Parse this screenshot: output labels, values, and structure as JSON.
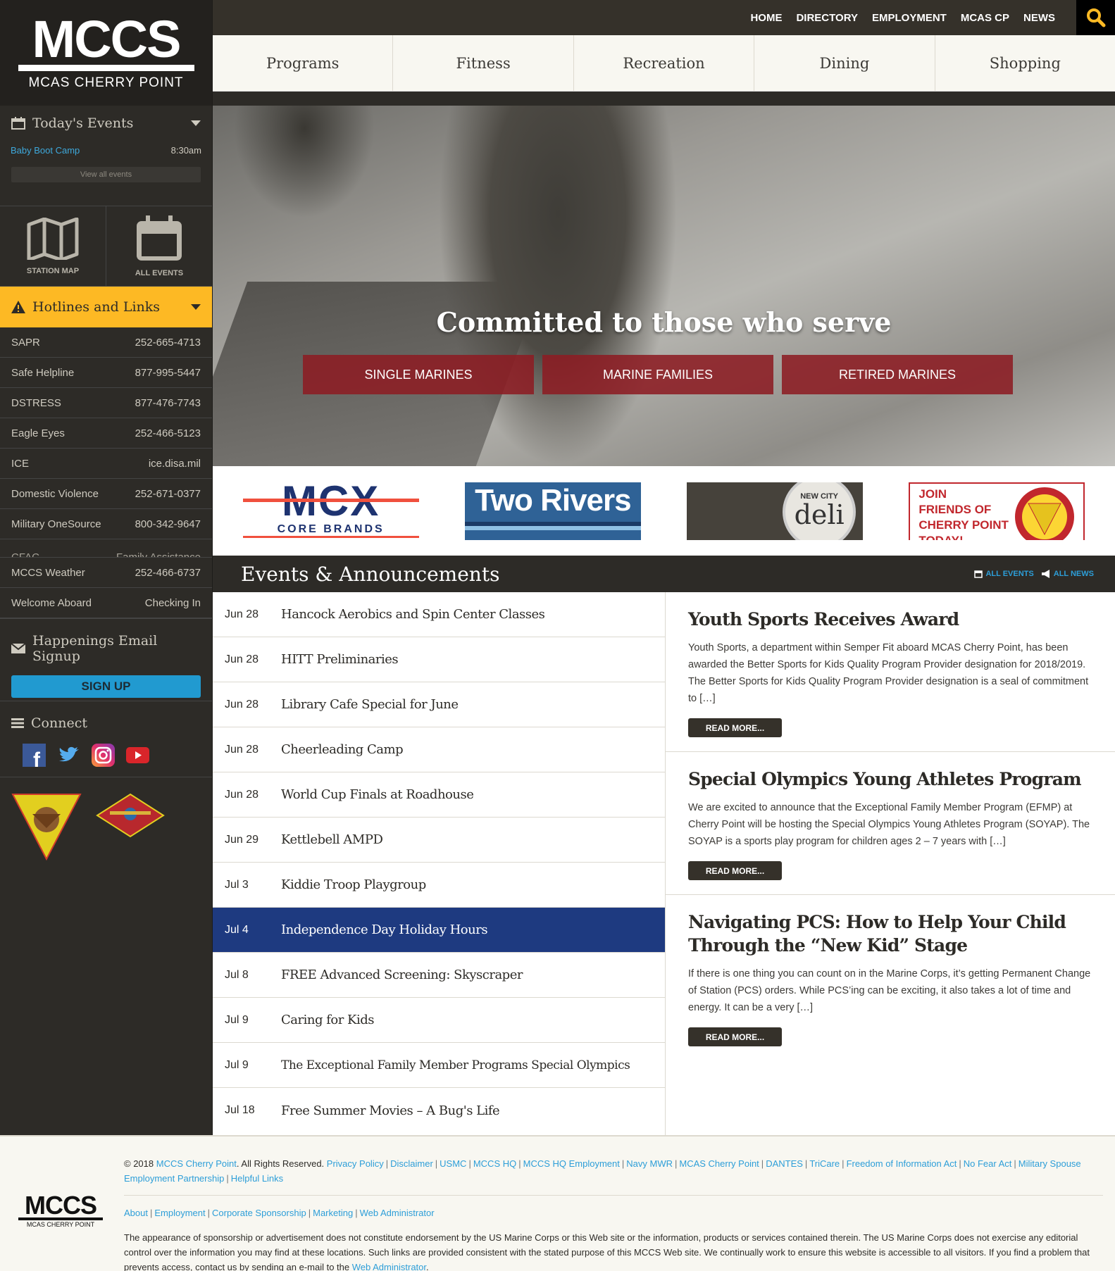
{
  "logo": {
    "mark": "MCCS",
    "subtitle": "MCAS CHERRY POINT"
  },
  "topnav": [
    "HOME",
    "DIRECTORY",
    "EMPLOYMENT",
    "MCAS CP",
    "NEWS"
  ],
  "mainnav": [
    "Programs",
    "Fitness",
    "Recreation",
    "Dining",
    "Shopping"
  ],
  "sidebar": {
    "today": {
      "title": "Today's Events",
      "events": [
        {
          "name": "Baby Boot Camp",
          "time": "8:30am"
        }
      ],
      "view_all": "View all events"
    },
    "tiles": [
      {
        "label": "STATION MAP",
        "icon": "map-icon"
      },
      {
        "label": "ALL EVENTS",
        "icon": "calendar-icon"
      }
    ],
    "hotlines": {
      "title": "Hotlines and Links",
      "items": [
        {
          "name": "SAPR",
          "value": "252-665-4713"
        },
        {
          "name": "Safe Helpline",
          "value": "877-995-5447"
        },
        {
          "name": "DSTRESS",
          "value": "877-476-7743"
        },
        {
          "name": "Eagle Eyes",
          "value": "252-466-5123"
        },
        {
          "name": "ICE",
          "value": "ice.disa.mil"
        },
        {
          "name": "Domestic Violence",
          "value": "252-671-0377"
        },
        {
          "name": "Military OneSource",
          "value": "800-342-9647"
        },
        {
          "name": "CFAC",
          "value": "Family Assistance"
        },
        {
          "name": "MCCS Weather",
          "value": "252-466-6737"
        },
        {
          "name": "Welcome Aboard",
          "value": "Checking In"
        }
      ]
    },
    "email": {
      "title": "Happenings Email Signup",
      "button": "SIGN UP"
    },
    "connect": {
      "title": "Connect",
      "social": [
        "facebook",
        "twitter",
        "instagram",
        "youtube"
      ]
    }
  },
  "hero": {
    "headline": "Committed to those who serve",
    "buttons": [
      "SINGLE MARINES",
      "MARINE FAMILIES",
      "RETIRED MARINES"
    ]
  },
  "sponsors": {
    "mcx": {
      "line1": "MCX",
      "line2": "CORE BRANDS"
    },
    "tworivers": "Two Rivers",
    "deli": {
      "top": "NEW CITY",
      "main": "deli"
    },
    "friends": {
      "lines": [
        "JOIN",
        "FRIENDS OF",
        "CHERRY POINT",
        "TODAY!"
      ]
    }
  },
  "events_section": {
    "title": "Events & Announcements",
    "all_events": "ALL EVENTS",
    "all_news": "ALL NEWS",
    "events": [
      {
        "date": "Jun 28",
        "name": "Hancock Aerobics and Spin Center Classes"
      },
      {
        "date": "Jun 28",
        "name": "HITT Preliminaries"
      },
      {
        "date": "Jun 28",
        "name": "Library Cafe Special for June"
      },
      {
        "date": "Jun 28",
        "name": "Cheerleading Camp"
      },
      {
        "date": "Jun 28",
        "name": "World Cup Finals at Roadhouse"
      },
      {
        "date": "Jun 29",
        "name": "Kettlebell AMPD"
      },
      {
        "date": "Jul 3",
        "name": "Kiddie Troop Playgroup"
      },
      {
        "date": "Jul 4",
        "name": "Independence Day Holiday Hours"
      },
      {
        "date": "Jul 8",
        "name": "FREE Advanced Screening: Skyscraper"
      },
      {
        "date": "Jul 9",
        "name": "Caring for Kids"
      },
      {
        "date": "Jul 9",
        "name": "The Exceptional Family Member Programs Special Olympics"
      },
      {
        "date": "Jul 18",
        "name": "Free Summer Movies – A Bug's Life"
      }
    ],
    "news": [
      {
        "title": "Youth Sports Receives Award",
        "excerpt": "Youth Sports, a department within Semper Fit aboard MCAS Cherry Point, has been awarded the Better Sports for Kids Quality Program Provider designation for 2018/2019. The Better Sports for Kids Quality Program Provider designation is a seal of commitment to […]",
        "button": "READ MORE..."
      },
      {
        "title": "Special Olympics Young Athletes Program",
        "excerpt": "We are excited to announce that the Exceptional Family Member Program (EFMP) at Cherry Point will be hosting the Special Olympics Young Athletes Program (SOYAP). The SOYAP is a sports play program for children ages 2 – 7 years with […]",
        "button": "READ MORE..."
      },
      {
        "title": "Navigating PCS: How to Help Your Child Through the “New Kid” Stage",
        "excerpt": "If there is one thing you can count on in the Marine Corps, it’s getting Permanent Change of Station (PCS) orders.  While PCS’ing can be exciting, it also takes a lot of time and energy.  It can be a very […]",
        "button": "READ MORE..."
      }
    ]
  },
  "footer": {
    "copyright_prefix": "© 2018",
    "copyright_org": "MCCS Cherry Point",
    "copyright_suffix": ". All Rights Reserved.",
    "links1": [
      "Privacy Policy",
      "Disclaimer",
      "USMC",
      "MCCS HQ",
      "MCCS HQ Employment",
      "Navy MWR",
      "MCAS Cherry Point",
      "DANTES",
      "TriCare",
      "Freedom of Information Act",
      "No Fear Act",
      "Military Spouse Employment Partnership",
      "Helpful Links"
    ],
    "links2": [
      "About",
      "Employment",
      "Corporate Sponsorship",
      "Marketing",
      "Web Administrator"
    ],
    "disclaimer": "The appearance of sponsorship or advertisement does not constitute endorsement by the US Marine Corps or this Web site or the information, products or services contained therein. The US Marine Corps does not exercise any editorial control over the information you may find at these locations. Such links are provided consistent with the stated purpose of this MCCS Web site. We continually work to ensure this website is accessible to all visitors. If you find a problem that prevents access, contact us by sending an e-mail to the",
    "disclaimer_link": "Web Administrator",
    "logo_mark": "MCCS",
    "logo_sub": "MCAS CHERRY POINT"
  },
  "colors": {
    "accent_yellow": "#fdb924",
    "link_blue": "#2d9ed8",
    "hero_red": "#8c1c23",
    "active_blue": "#1e3a80"
  }
}
